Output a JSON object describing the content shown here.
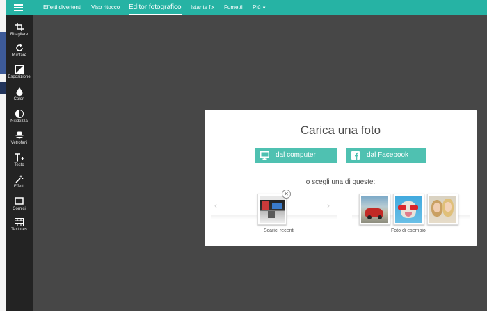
{
  "nav": {
    "items": [
      {
        "label": "Effetti divertenti"
      },
      {
        "label": "Viso ritocco"
      },
      {
        "label": "Editor fotografico"
      },
      {
        "label": "Istante fix"
      },
      {
        "label": "Fumetti"
      },
      {
        "label": "Più"
      }
    ]
  },
  "sidebar": {
    "tools": [
      {
        "label": "Ritagliare",
        "icon": "crop-icon"
      },
      {
        "label": "Ruotare",
        "icon": "rotate-icon"
      },
      {
        "label": "Esposizione",
        "icon": "exposure-icon"
      },
      {
        "label": "Colori",
        "icon": "drop-icon"
      },
      {
        "label": "Nitidezza",
        "icon": "half-circle-icon"
      },
      {
        "label": "Vetrofani",
        "icon": "hat-mustache-icon"
      },
      {
        "label": "Testo",
        "icon": "text-plus-icon"
      },
      {
        "label": "Effetti",
        "icon": "magic-wand-icon"
      },
      {
        "label": "Cornici",
        "icon": "frame-icon"
      },
      {
        "label": "Textures",
        "icon": "texture-icon"
      }
    ]
  },
  "panel": {
    "title": "Carica una foto",
    "btn_computer": "dal computer",
    "btn_facebook": "dal Facebook",
    "subtitle": "o scegli una di queste:",
    "recent_caption": "Scarici recenti",
    "sample_caption": "Foto di esempio",
    "prev_arrow": "‹",
    "next_arrow": "›",
    "close_glyph": "✕"
  },
  "colors": {
    "accent": "#26b3a4",
    "button": "#4fc1b1",
    "sidebar": "#232323",
    "workspace": "#474747"
  }
}
